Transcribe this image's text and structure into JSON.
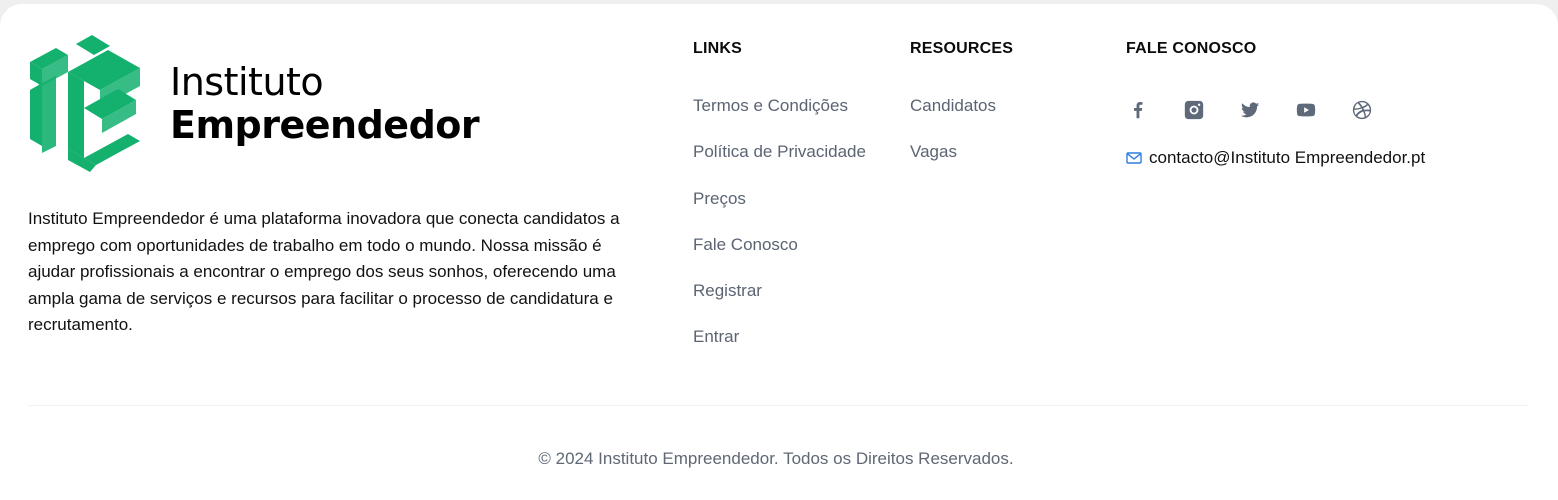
{
  "brand": {
    "name_line1": "Instituto",
    "name_line2": "Empreendedor",
    "logo_icon": "ie-logo-icon",
    "accent_color": "#13b06e"
  },
  "about": "Instituto Empreendedor é uma plataforma inovadora que conecta candidatos a emprego com oportunidades de trabalho em todo o mundo. Nossa missão é ajudar profissionais a encontrar o emprego dos seus sonhos, oferecendo uma ampla gama de serviços e recursos para facilitar o processo de candidatura e recrutamento.",
  "links": {
    "heading": "LINKS",
    "items": [
      "Termos e Condições",
      "Política de Privacidade",
      "Preços",
      "Fale Conosco",
      "Registrar",
      "Entrar"
    ]
  },
  "resources": {
    "heading": "RESOURCES",
    "items": [
      "Candidatos",
      "Vagas"
    ]
  },
  "contact": {
    "heading": "FALE CONOSCO",
    "socials": [
      "facebook-icon",
      "instagram-icon",
      "twitter-icon",
      "youtube-icon",
      "dribbble-icon"
    ],
    "email_icon": "mail-icon",
    "email": "contacto@Instituto Empreendedor.pt"
  },
  "footer": {
    "copyright": "© 2024 Instituto Empreendedor. Todos os Direitos Reservados."
  }
}
